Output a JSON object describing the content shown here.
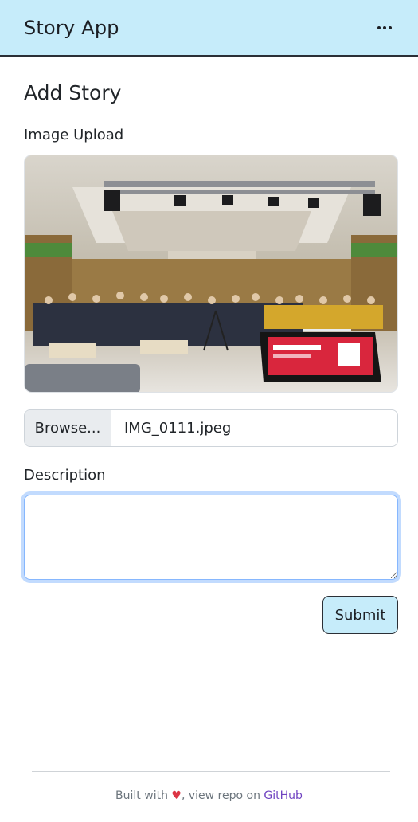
{
  "navbar": {
    "brand": "Story App",
    "menu_icon": "ellipsis-horizontal-icon"
  },
  "page": {
    "title": "Add Story"
  },
  "form": {
    "image_label": "Image Upload",
    "file_button_label": "Browse...",
    "file_name": "IMG_0111.jpeg",
    "description_label": "Description",
    "description_value": "",
    "submit_label": "Submit"
  },
  "footer": {
    "text_before": "Built with ",
    "heart": "♥",
    "text_middle": ", view repo on ",
    "link_label": "GitHub"
  },
  "colors": {
    "navbar_bg": "#c6ecfa",
    "heart": "#dc3545",
    "link": "#6f42c1",
    "focus": "#86b7fe"
  }
}
